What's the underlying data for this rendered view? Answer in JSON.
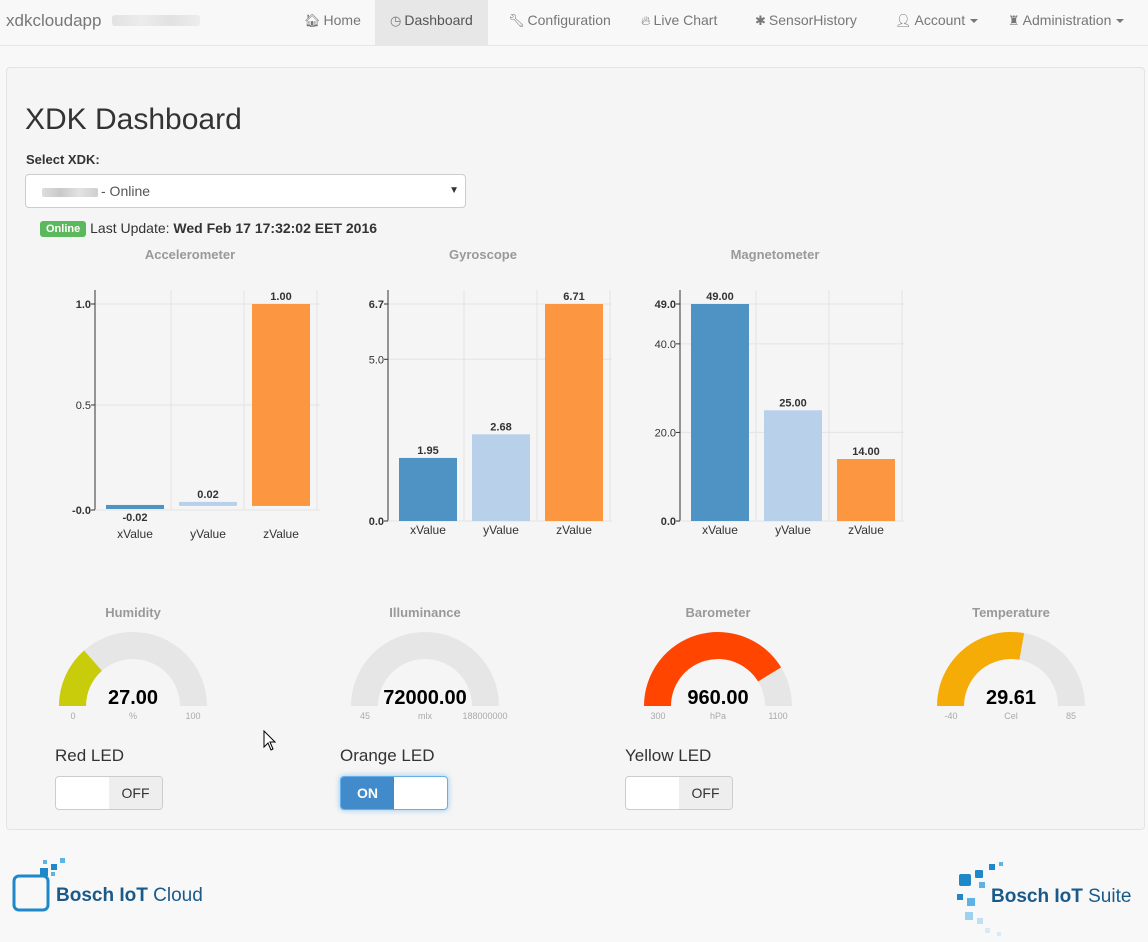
{
  "navbar": {
    "brand": "xdkcloudapp",
    "items": [
      {
        "label": "Home",
        "icon": "home-icon",
        "glyph": "🏠︎"
      },
      {
        "label": "Dashboard",
        "icon": "dashboard-icon",
        "glyph": "◷"
      },
      {
        "label": "Configuration",
        "icon": "wrench-icon",
        "glyph": "🔧︎"
      },
      {
        "label": "Live Chart",
        "icon": "fire-icon",
        "glyph": "🔥︎"
      },
      {
        "label": "SensorHistory",
        "icon": "asterisk-icon",
        "glyph": "✱"
      },
      {
        "label": "Account",
        "icon": "user-icon",
        "glyph": "👤︎"
      },
      {
        "label": "Administration",
        "icon": "tower-icon",
        "glyph": "♜"
      }
    ]
  },
  "main": {
    "title": "XDK Dashboard",
    "select_label": "Select XDK:",
    "select_value": "- Online",
    "status_badge": "Online",
    "last_update_label": "Last Update:",
    "last_update_value": "Wed Feb 17 17:32:02 EET 2016"
  },
  "colors": {
    "blue": "#4f93c5",
    "lightblue": "#b9d0ea",
    "orange": "#fd9640",
    "gauge_track": "#e6e6e6",
    "humidity": "#c8cc0a",
    "barometer": "#ff4500",
    "temperature": "#f5ac07"
  },
  "chart_data": [
    {
      "type": "bar",
      "title": "Accelerometer",
      "categories": [
        "xValue",
        "yValue",
        "zValue"
      ],
      "values": [
        -0.02,
        0.02,
        1.0
      ],
      "value_labels": [
        "-0.02",
        "0.02",
        "1.00"
      ],
      "ylim": [
        -0.02,
        1.0
      ],
      "yticks": [
        {
          "v": 1.0,
          "label": "1.0"
        },
        {
          "v": 0.5,
          "label": "0.5"
        },
        {
          "v": -0.02,
          "label": "-0.0"
        }
      ],
      "grid": true
    },
    {
      "type": "bar",
      "title": "Gyroscope",
      "categories": [
        "xValue",
        "yValue",
        "zValue"
      ],
      "values": [
        1.95,
        2.68,
        6.71
      ],
      "value_labels": [
        "1.95",
        "2.68",
        "6.71"
      ],
      "ylim": [
        0,
        6.71
      ],
      "yticks": [
        {
          "v": 6.71,
          "label": "6.7"
        },
        {
          "v": 5.0,
          "label": "5.0"
        },
        {
          "v": 0,
          "label": "0.0"
        }
      ],
      "grid": true
    },
    {
      "type": "bar",
      "title": "Magnetometer",
      "categories": [
        "xValue",
        "yValue",
        "zValue"
      ],
      "values": [
        49.0,
        25.0,
        14.0
      ],
      "value_labels": [
        "49.00",
        "25.00",
        "14.00"
      ],
      "ylim": [
        0,
        49.0
      ],
      "yticks": [
        {
          "v": 49.0,
          "label": "49.0"
        },
        {
          "v": 40.0,
          "label": "40.0"
        },
        {
          "v": 20.0,
          "label": "20.0"
        },
        {
          "v": 0,
          "label": "0.0"
        }
      ],
      "grid": true
    }
  ],
  "gauges": [
    {
      "title": "Humidity",
      "value": 27.0,
      "display": "27.00",
      "min": 0,
      "max": 100,
      "min_label": "0",
      "max_label": "100",
      "unit": "%",
      "color": "#c8cc0a"
    },
    {
      "title": "Illuminance",
      "value": 72000.0,
      "display": "72000.00",
      "min": 45,
      "max": 188000000,
      "min_label": "45",
      "max_label": "188000000",
      "unit": "mlx",
      "color": "#c8cc0a"
    },
    {
      "title": "Barometer",
      "value": 960.0,
      "display": "960.00",
      "min": 300,
      "max": 1100,
      "min_label": "300",
      "max_label": "1100",
      "unit": "hPa",
      "color": "#ff4500"
    },
    {
      "title": "Temperature",
      "value": 29.61,
      "display": "29.61",
      "min": -40,
      "max": 85,
      "min_label": "-40",
      "max_label": "85",
      "unit": "Cel",
      "color": "#f5ac07"
    }
  ],
  "leds": [
    {
      "label": "Red LED",
      "state": "OFF",
      "on": false
    },
    {
      "label": "Orange LED",
      "state": "ON",
      "on": true
    },
    {
      "label": "Yellow LED",
      "state": "OFF",
      "on": false
    }
  ],
  "footer": {
    "left_logo_bold": "Bosch IoT",
    "left_logo_light": " Cloud",
    "right_logo_bold": "Bosch IoT",
    "right_logo_light": " Suite"
  }
}
